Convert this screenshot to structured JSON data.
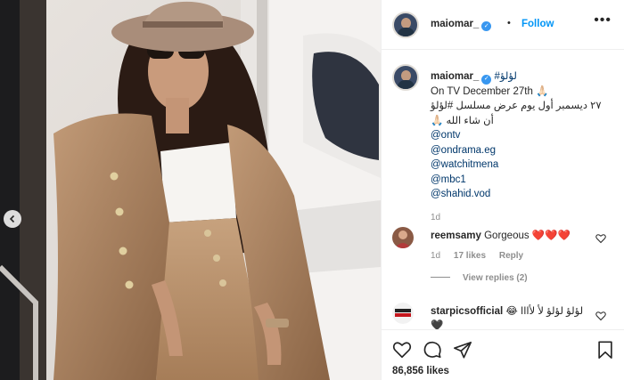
{
  "post": {
    "username": "maiomar_",
    "follow_label": "Follow",
    "separator": "•",
    "more_label": "•••",
    "verified_mark": "✓",
    "colors": {
      "link": "#00376b",
      "follow": "#0095f6",
      "verified": "#3897f0",
      "muted": "#8e8e8e",
      "heart": "#e0242e"
    }
  },
  "caption": {
    "username": "maiomar_",
    "title_tag": "#لؤلؤ",
    "line_en": "On TV December 27th 🙏🏻",
    "line_ar_1": "٢٧ ديسمبر أول يوم عرض مسلسل #لؤلؤ",
    "line_ar_2": "أن شاء الله 🙏🏻",
    "mentions": [
      "@ontv",
      "@ondrama.eg",
      "@watchitmena",
      "@mbc1",
      "@shahid.vod"
    ],
    "time_ago": "1d"
  },
  "comments": [
    {
      "username": "reemsamy",
      "text": "Gorgeous ❤️❤️❤️",
      "time_ago": "1d",
      "likes": "17 likes",
      "reply_label": "Reply",
      "view_replies": "View replies (2)"
    },
    {
      "username": "starpicsofficial",
      "text": "لؤلؤ لؤلؤ لأ لأااا 😂",
      "text_line2": "🖤"
    }
  ],
  "footer": {
    "likes": "86,856 likes",
    "icons": [
      "heart-icon",
      "comment-icon",
      "share-icon",
      "bookmark-icon"
    ]
  },
  "photo": {
    "icons": [
      "chevron-left-icon"
    ]
  }
}
